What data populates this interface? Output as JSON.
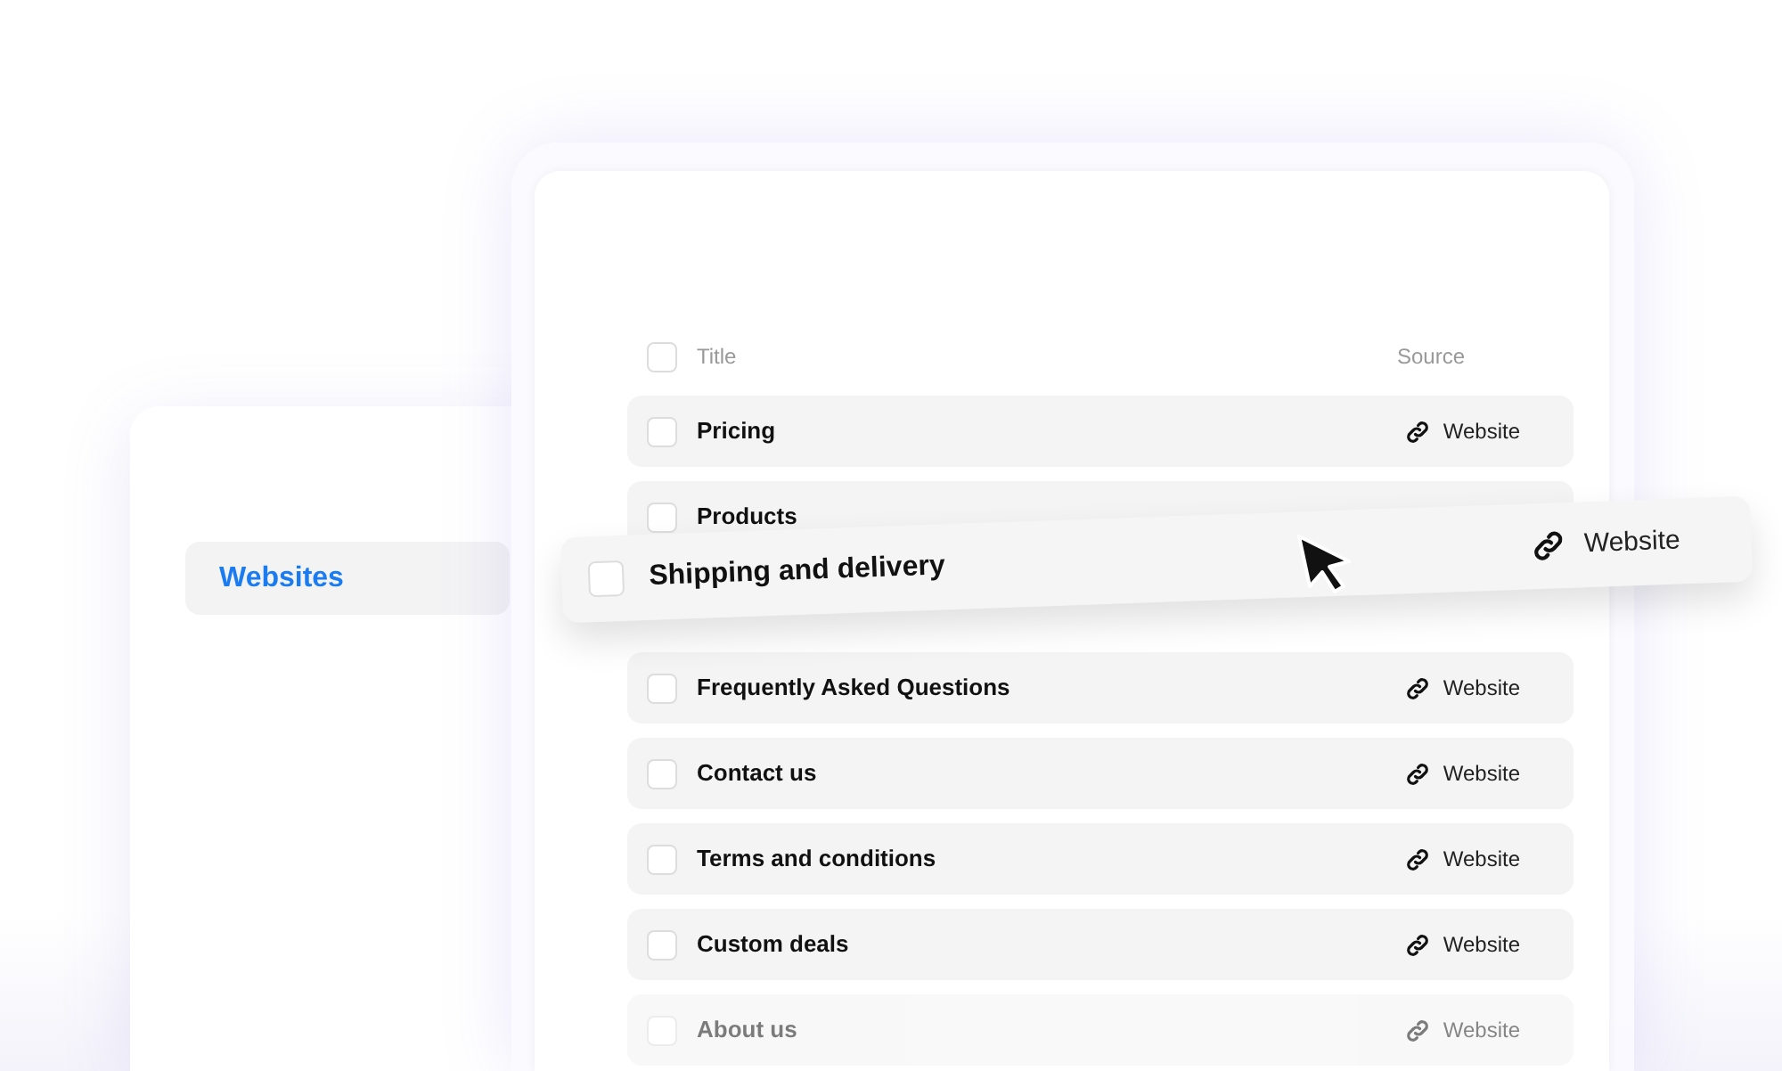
{
  "sidebar": {
    "items": [
      {
        "label": "Websites",
        "selected": true
      }
    ]
  },
  "table": {
    "header": {
      "checked": false,
      "columns": [
        "Title",
        "Source"
      ]
    },
    "rows": [
      {
        "title": "Pricing",
        "source": "Website",
        "checked": false
      },
      {
        "title": "Products",
        "checked": false
      },
      {
        "kind": "drop-slot"
      },
      {
        "title": "Frequently Asked Questions",
        "source": "Website",
        "checked": false
      },
      {
        "title": "Contact us",
        "source": "Website",
        "checked": false
      },
      {
        "title": "Terms and conditions",
        "source": "Website",
        "checked": false
      },
      {
        "title": "Custom deals",
        "source": "Website",
        "checked": false
      },
      {
        "title": "About us",
        "source": "Website",
        "checked": false
      }
    ],
    "dragged_row": {
      "title": "Shipping and delivery",
      "source": "Website",
      "checked": false
    }
  }
}
